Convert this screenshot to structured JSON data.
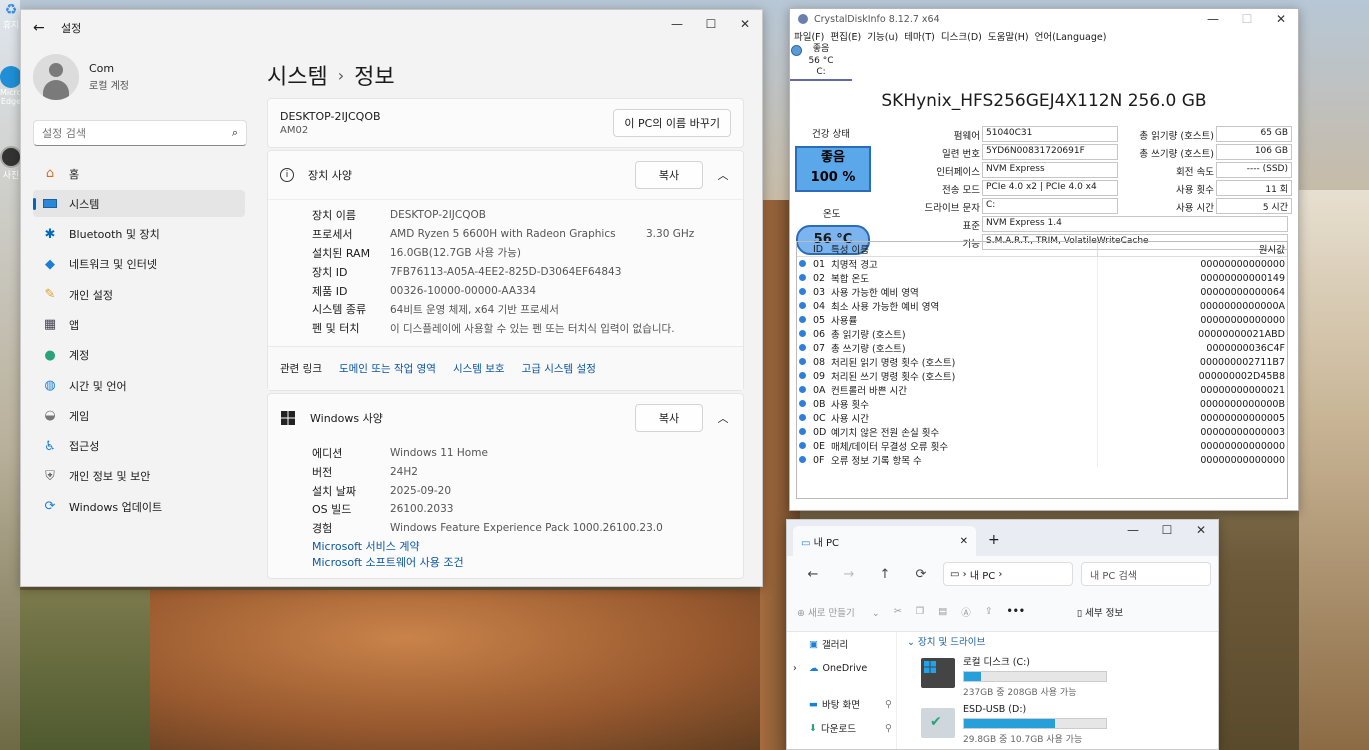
{
  "desktop": {
    "icons": [
      "휴지",
      "Microsoft Edge",
      "사진"
    ]
  },
  "settings": {
    "title": "설정",
    "user": {
      "name": "Com",
      "role": "로컬 계정"
    },
    "search_placeholder": "설정 검색",
    "nav": [
      "홈",
      "시스템",
      "Bluetooth 및 장치",
      "네트워크 및 인터넷",
      "개인 설정",
      "앱",
      "계정",
      "시간 및 언어",
      "게임",
      "접근성",
      "개인 정보 및 보안",
      "Windows 업데이트"
    ],
    "nav_active": 1,
    "breadcrumb": {
      "parent": "시스템",
      "sep": "›",
      "current": "정보"
    },
    "pc": {
      "name": "DESKTOP-2IJCQOB",
      "model": "AM02",
      "rename": "이 PC의 이름 바꾸기"
    },
    "device": {
      "title": "장치 사양",
      "copy": "복사",
      "rows": [
        {
          "k": "장치 이름",
          "v": "DESKTOP-2IJCQOB",
          "v2": ""
        },
        {
          "k": "프로세서",
          "v": "AMD Ryzen 5 6600H with Radeon Graphics",
          "v2": "3.30 GHz"
        },
        {
          "k": "설치된 RAM",
          "v": "16.0GB(12.7GB 사용 가능)",
          "v2": ""
        },
        {
          "k": "장치 ID",
          "v": "7FB76113-A05A-4EE2-825D-D3064EF64843",
          "v2": ""
        },
        {
          "k": "제품 ID",
          "v": "00326-10000-00000-AA334",
          "v2": ""
        },
        {
          "k": "시스템 종류",
          "v": "64비트 운영 체제, x64 기반 프로세서",
          "v2": ""
        },
        {
          "k": "펜 및 터치",
          "v": "이 디스플레이에 사용할 수 있는 펜 또는 터치식 입력이 없습니다.",
          "v2": ""
        }
      ]
    },
    "related": {
      "label": "관련 링크",
      "links": [
        "도메인 또는 작업 영역",
        "시스템 보호",
        "고급 시스템 설정"
      ]
    },
    "windows": {
      "title": "Windows 사양",
      "copy": "복사",
      "rows": [
        {
          "k": "에디션",
          "v": "Windows 11 Home"
        },
        {
          "k": "버전",
          "v": "24H2"
        },
        {
          "k": "설치 날짜",
          "v": "2025-09-20"
        },
        {
          "k": "OS 빌드",
          "v": "26100.2033"
        },
        {
          "k": "경험",
          "v": "Windows Feature Experience Pack 1000.26100.23.0"
        }
      ],
      "links": [
        "Microsoft 서비스 계약",
        "Microsoft 소프트웨어 사용 조건"
      ]
    }
  },
  "cdi": {
    "title": "CrystalDiskInfo 8.12.7 x64",
    "menu": [
      "파일(F)",
      "편집(E)",
      "기능(u)",
      "테마(T)",
      "디스크(D)",
      "도움말(H)",
      "언어(Language)"
    ],
    "disk_tab": {
      "status": "좋음",
      "temp": "56 °C",
      "letter": "C:"
    },
    "model": "SKHynix_HFS256GEJ4X112N 256.0 GB",
    "health_label": "건강 상태",
    "health": "좋음",
    "health_pct": "100 %",
    "temp_label": "온도",
    "temp": "56 °C",
    "fields": {
      "firmware_l": "펌웨어",
      "firmware": "51040C31",
      "serial_l": "일련 번호",
      "serial": "5YD6N00831720691F",
      "iface_l": "인터페이스",
      "iface": "NVM Express",
      "mode_l": "전송 모드",
      "mode": "PCIe 4.0 x2 | PCIe 4.0 x4",
      "drive_l": "드라이브 문자",
      "drive": "C:",
      "std_l": "표준",
      "std": "NVM Express 1.4",
      "feat_l": "기능",
      "feat": "S.M.A.R.T., TRIM, VolatileWriteCache",
      "reads_l": "총 읽기량 (호스트)",
      "reads": "65 GB",
      "writes_l": "총 쓰기량 (호스트)",
      "writes": "106 GB",
      "rpm_l": "회전 속도",
      "rpm": "---- (SSD)",
      "count_l": "사용 횟수",
      "count": "11 회",
      "hours_l": "사용 시간",
      "hours": "5 시간"
    },
    "smart_headers": {
      "id": "ID",
      "name": "특성 이름",
      "raw": "원시값"
    },
    "smart": [
      [
        "01",
        "치명적 경고",
        "00000000000000"
      ],
      [
        "02",
        "복합 온도",
        "00000000000149"
      ],
      [
        "03",
        "사용 가능한 예비 영역",
        "00000000000064"
      ],
      [
        "04",
        "최소 사용 가능한 예비 영역",
        "0000000000000A"
      ],
      [
        "05",
        "사용률",
        "00000000000000"
      ],
      [
        "06",
        "총 읽기량 (호스트)",
        "00000000021ABD"
      ],
      [
        "07",
        "총 쓰기량 (호스트)",
        "0000000036C4F"
      ],
      [
        "08",
        "처리된 읽기 명령 횟수 (호스트)",
        "000000002711B7"
      ],
      [
        "09",
        "처리된 쓰기 명령 횟수 (호스트)",
        "000000002D45B8"
      ],
      [
        "0A",
        "컨트롤러 바쁜 시간",
        "00000000000021"
      ],
      [
        "0B",
        "사용 횟수",
        "0000000000000B"
      ],
      [
        "0C",
        "사용 시간",
        "00000000000005"
      ],
      [
        "0D",
        "예기치 않은 전원 손실 횟수",
        "00000000000003"
      ],
      [
        "0E",
        "매체/데이터 무결성 오류 횟수",
        "00000000000000"
      ],
      [
        "0F",
        "오류 정보 기록 항목 수",
        "00000000000000"
      ]
    ]
  },
  "explorer": {
    "tab": "내 PC",
    "addr": "내 PC",
    "search": "내 PC 검색",
    "new": "새로 만들기",
    "details": "세부 정보",
    "left": [
      "갤러리",
      "OneDrive",
      "바탕 화면",
      "다운로드"
    ],
    "group": "장치 및 드라이브",
    "drives": [
      {
        "name": "로컬 디스크 (C:)",
        "sub": "237GB 중 208GB 사용 가능",
        "used": 0.12
      },
      {
        "name": "ESD-USB (D:)",
        "sub": "29.8GB 중 10.7GB 사용 가능",
        "used": 0.64
      }
    ]
  }
}
